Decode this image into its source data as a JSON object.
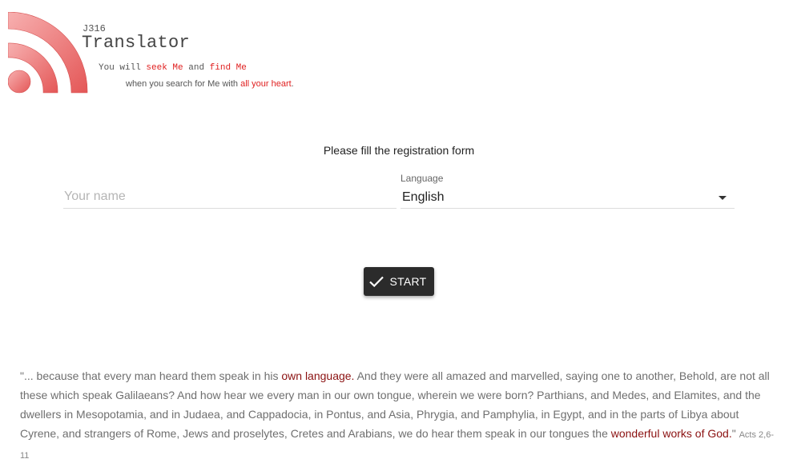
{
  "header": {
    "subtitle": "J316",
    "title": "Translator",
    "tagline_line1": {
      "part1": "You will ",
      "highlight1": "seek Me",
      "part2": " and ",
      "highlight2": "find Me"
    },
    "tagline_line2": {
      "part1": "when you search for Me with ",
      "highlight": "all your heart",
      "part2": "."
    },
    "logo_icon": "rss-icon",
    "logo_color": "#e56b6b"
  },
  "form": {
    "title": "Please fill the registration form",
    "name_placeholder": "Your name",
    "name_value": "",
    "language_label": "Language",
    "language_value": "English",
    "start_label": "START",
    "start_icon": "check-icon"
  },
  "verse": {
    "part1": "\"... because that every man heard them speak in his ",
    "emph1": "own language.",
    "part2": " And they were all amazed and marvelled, saying one to another, Behold, are not all these which speak Galilaeans? And how hear we every man in our own tongue, wherein we were born? Parthians, and Medes, and Elamites, and the dwellers in Mesopotamia, and in Judaea, and Cappadocia, in Pontus, and Asia, Phrygia, and Pamphylia, in Egypt, and in the parts of Libya about Cyrene, and strangers of Rome, Jews and proselytes, Cretes and Arabians, we do hear them speak in our tongues the ",
    "emph2": "wonderful works of God.",
    "part3": "\" ",
    "reference": "Acts 2,6-11"
  }
}
